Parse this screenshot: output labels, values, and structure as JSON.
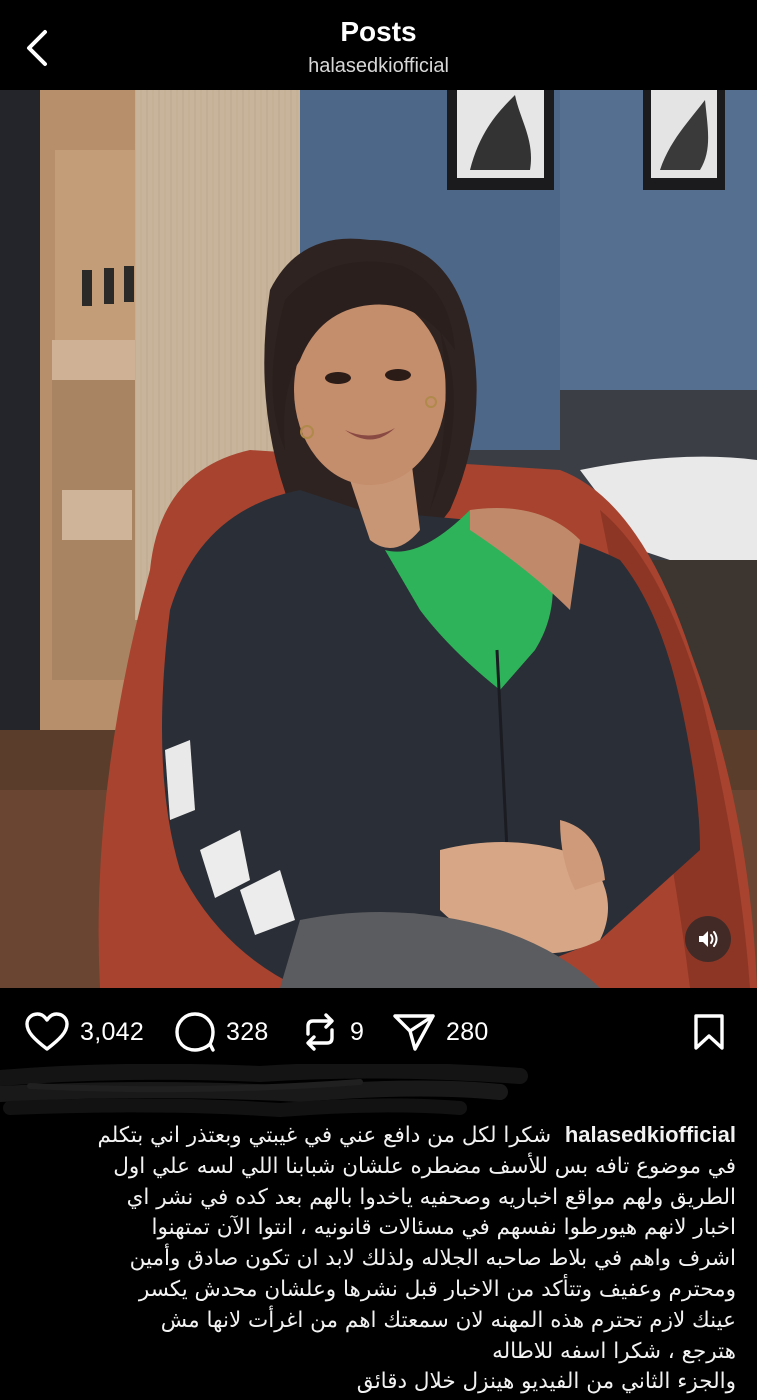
{
  "header": {
    "title": "Posts",
    "username": "halasedkiofficial"
  },
  "icons": {
    "back": "chevron-left-icon",
    "like": "heart-icon",
    "comment": "comment-bubble-icon",
    "repost": "repost-icon",
    "share": "paper-plane-icon",
    "save": "bookmark-icon",
    "sound": "speaker-icon"
  },
  "actions": {
    "likes": "3,042",
    "comments": "328",
    "reposts": "9",
    "shares": "280"
  },
  "caption": {
    "username": "halasedkiofficial",
    "lines": [
      "شكرا لكل من دافع عني في غيبتي وبعتذر اني بتكلم",
      "في موضوع تافه بس للأسف مضطره علشان شبابنا اللي لسه علي اول",
      "الطريق ولهم مواقع اخباريه وصحفيه ياخدوا بالهم بعد كده في نشر اي",
      "اخبار لانهم هيورطوا نفسهم في مسئالات قانونيه ، انتوا الآن تمتهنوا",
      "اشرف واهم في بلاط صاحبه الجلاله ولذلك لابد ان تكون صادق وأمين",
      "ومحترم وعفيف وتتأكد من الاخبار قبل نشرها وعلشان محدش يكسر",
      "عينك لازم تحترم هذه المهنه لان سمعتك اهم من اغرأت لانها مش",
      "هترجع ، شكرا اسفه للاطاله",
      "والجزء الثاني من الفيديو هينزل خلال دقائق"
    ]
  },
  "colors": {
    "background": "#000000",
    "text": "#ffffff",
    "top_green": "#2fb35a",
    "chair": "#a8432f",
    "jacket": "#2a2e36"
  }
}
